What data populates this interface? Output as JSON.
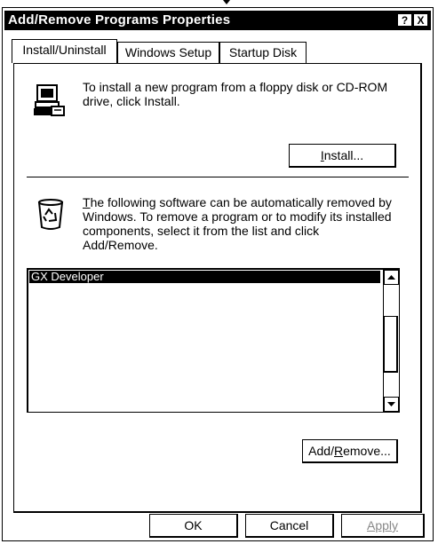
{
  "window": {
    "title": "Add/Remove Programs Properties",
    "help_btn": "?",
    "close_btn": "X"
  },
  "tabs": [
    {
      "label": "Install/Uninstall",
      "active": true
    },
    {
      "label": "Windows Setup",
      "active": false
    },
    {
      "label": "Startup Disk",
      "active": false
    }
  ],
  "install_section": {
    "text_line1": "To install a new program from a floppy disk or CD-ROM",
    "text_line2": "drive, click Install.",
    "install_button": {
      "mnemonic": "I",
      "rest": "nstall..."
    }
  },
  "uninstall_section": {
    "line1": {
      "mnemonic": "T",
      "rest": "he following software can be automatically removed by"
    },
    "line2": "Windows. To remove a program or to modify its installed",
    "line3": "components, select it from the list and click",
    "line4": "Add/Remove.",
    "programs": [
      "GX Developer"
    ],
    "add_remove_button": {
      "pre": "Add/",
      "mnemonic": "R",
      "rest": "emove..."
    }
  },
  "footer": {
    "ok": "OK",
    "cancel": "Cancel",
    "apply": "Apply"
  },
  "icons": [
    "computer-install-icon",
    "recycle-bin-icon",
    "up-arrow-icon",
    "down-arrow-icon"
  ]
}
